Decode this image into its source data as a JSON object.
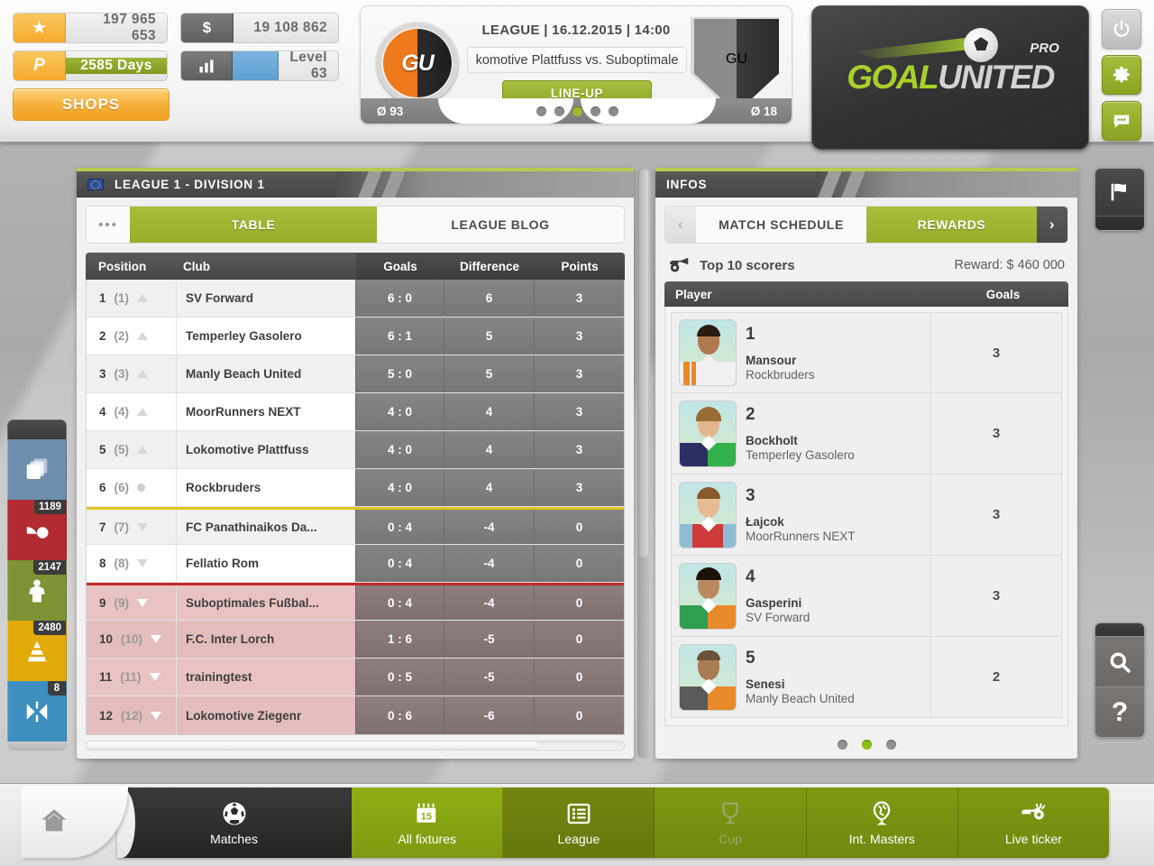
{
  "header": {
    "resources": [
      {
        "icon": "star-icon",
        "value": "197 965 653",
        "style": "gold"
      },
      {
        "icon": "dollar-icon",
        "value": "19 108 862",
        "style": "dark"
      },
      {
        "icon": "premium-p-icon",
        "value": "2585 Days",
        "style": "gold-green"
      },
      {
        "icon": "bar-chart-icon",
        "value": "Level 63",
        "style": "dark-blue"
      }
    ],
    "shops_label": "SHOPS",
    "match": {
      "meta": "LEAGUE | 16.12.2015 | 14:00",
      "fixture": "komotive Plattfuss vs. Suboptimale",
      "lineup_label": "LINE-UP",
      "home_avg": "Ø 93",
      "away_avg": "Ø 18",
      "home_crest_text": "GU",
      "away_crest_text": "GU",
      "dots": 5,
      "active_dot": 2
    },
    "logo": {
      "primary": "GOAL",
      "secondary": "UNITED",
      "suffix": "PRO"
    },
    "buttons": [
      {
        "name": "power-icon",
        "glyph": "⏻",
        "style": "gray"
      },
      {
        "name": "gear-icon",
        "glyph": "✲",
        "style": "green"
      },
      {
        "name": "chat-icon",
        "glyph": "●●●",
        "style": "green"
      }
    ]
  },
  "left_rail": [
    {
      "name": "sidebar-item-squad",
      "badge": "",
      "color": "#6e8fae"
    },
    {
      "name": "sidebar-item-injuries",
      "badge": "1189",
      "color": "#b22b30"
    },
    {
      "name": "sidebar-item-players",
      "badge": "2147",
      "color": "#7d9335"
    },
    {
      "name": "sidebar-item-training",
      "badge": "2480",
      "color": "#e2ab08"
    },
    {
      "name": "sidebar-item-tactics",
      "badge": "8",
      "color": "#3d8fbf"
    }
  ],
  "right_rail": [
    {
      "name": "flag-icon"
    },
    {
      "name": "search-icon"
    },
    {
      "name": "help-icon",
      "glyph": "?"
    }
  ],
  "league_panel": {
    "title": "LEAGUE 1 - DIVISION 1",
    "tabs": [
      {
        "label": "•••",
        "active": false,
        "name": "tab-more"
      },
      {
        "label": "TABLE",
        "active": true,
        "name": "tab-table"
      },
      {
        "label": "LEAGUE BLOG",
        "active": false,
        "name": "tab-league-blog"
      }
    ],
    "columns": [
      "Position",
      "Club",
      "Goals",
      "Difference",
      "Points"
    ],
    "rows": [
      {
        "pos": "1",
        "prev": "(1)",
        "trend": "up",
        "club": "SV Forward",
        "goals": "6 : 0",
        "diff": "6",
        "points": "3",
        "zone": "normal"
      },
      {
        "pos": "2",
        "prev": "(2)",
        "trend": "up",
        "club": "Temperley Gasolero",
        "goals": "6 : 1",
        "diff": "5",
        "points": "3",
        "zone": "normal"
      },
      {
        "pos": "3",
        "prev": "(3)",
        "trend": "up",
        "club": "Manly Beach United",
        "goals": "5 : 0",
        "diff": "5",
        "points": "3",
        "zone": "normal"
      },
      {
        "pos": "4",
        "prev": "(4)",
        "trend": "up",
        "club": "MoorRunners NEXT",
        "goals": "4 : 0",
        "diff": "4",
        "points": "3",
        "zone": "normal"
      },
      {
        "pos": "5",
        "prev": "(5)",
        "trend": "up",
        "club": "Lokomotive Plattfuss",
        "goals": "4 : 0",
        "diff": "4",
        "points": "3",
        "zone": "normal"
      },
      {
        "pos": "6",
        "prev": "(6)",
        "trend": "same",
        "club": "Rockbruders",
        "goals": "4 : 0",
        "diff": "4",
        "points": "3",
        "zone": "normal"
      },
      {
        "pos": "7",
        "prev": "(7)",
        "trend": "down",
        "club": "FC Panathinaikos Da...",
        "goals": "0 : 4",
        "diff": "-4",
        "points": "0",
        "zone": "yellow"
      },
      {
        "pos": "8",
        "prev": "(8)",
        "trend": "down",
        "club": "Fellatio Rom",
        "goals": "0 : 4",
        "diff": "-4",
        "points": "0",
        "zone": "normal"
      },
      {
        "pos": "9",
        "prev": "(9)",
        "trend": "down",
        "club": "Suboptimales Fußbal...",
        "goals": "0 : 4",
        "diff": "-4",
        "points": "0",
        "zone": "red"
      },
      {
        "pos": "10",
        "prev": "(10)",
        "trend": "down",
        "club": "F.C. Inter Lorch",
        "goals": "1 : 6",
        "diff": "-5",
        "points": "0",
        "zone": "reldown"
      },
      {
        "pos": "11",
        "prev": "(11)",
        "trend": "down",
        "club": "trainingtest",
        "goals": "0 : 5",
        "diff": "-5",
        "points": "0",
        "zone": "reldown"
      },
      {
        "pos": "12",
        "prev": "(12)",
        "trend": "down",
        "club": "Lokomotive Ziegenr",
        "goals": "0 : 6",
        "diff": "-6",
        "points": "0",
        "zone": "reldown"
      }
    ]
  },
  "infos_panel": {
    "title": "INFOS",
    "tabs": [
      {
        "label": "‹",
        "active": false,
        "name": "tab-prev-arrow"
      },
      {
        "label": "MATCH SCHEDULE",
        "active": false,
        "name": "tab-match-schedule"
      },
      {
        "label": "REWARDS",
        "active": true,
        "name": "tab-rewards"
      },
      {
        "label": "›",
        "active": false,
        "name": "tab-next-arrow"
      }
    ],
    "section_title": "Top 10 scorers",
    "reward": "Reward: $ 460 000",
    "columns": [
      "Player",
      "Goals"
    ],
    "scorers": [
      {
        "rank": "1",
        "name": "Mansour",
        "club": "Rockbruders",
        "goals": "3",
        "shirt_a": "#f0f0f0",
        "shirt_b": "#e8892a",
        "hair": "#2b1c12",
        "skin": "#b0784f"
      },
      {
        "rank": "2",
        "name": "Bockholt",
        "club": "Temperley Gasolero",
        "goals": "3",
        "shirt_a": "#2c2f63",
        "shirt_b": "#33b14a",
        "hair": "#9a6b37",
        "skin": "#e3b58c"
      },
      {
        "rank": "3",
        "name": "Łajcok",
        "club": "MoorRunners NEXT",
        "goals": "3",
        "shirt_a": "#8fbcd4",
        "shirt_b": "#cf3b3b",
        "hair": "#8a5a2c",
        "skin": "#e6bb95"
      },
      {
        "rank": "4",
        "name": "Gasperini",
        "club": "SV Forward",
        "goals": "3",
        "shirt_a": "#2f9e4f",
        "shirt_b": "#e8892a",
        "hair": "#1d1208",
        "skin": "#b98a62"
      },
      {
        "rank": "5",
        "name": "Senesi",
        "club": "Manly Beach United",
        "goals": "2",
        "shirt_a": "#5a5a5a",
        "shirt_b": "#e8892a",
        "hair": "#6b523a",
        "skin": "#a97c54"
      }
    ],
    "page_dots": 3,
    "active_page_dot": 1
  },
  "bottom_nav": {
    "home_label": "",
    "items": [
      {
        "label": "Matches",
        "icon": "soccer-ball-icon",
        "style": "dark",
        "name": "nav-matches"
      },
      {
        "label": "All fixtures",
        "icon": "calendar-15-icon",
        "style": "gbright",
        "name": "nav-all-fixtures",
        "badge": "15"
      },
      {
        "label": "League",
        "icon": "list-icon",
        "style": "gmid",
        "name": "nav-league"
      },
      {
        "label": "Cup",
        "icon": "trophy-icon",
        "style": "g dim",
        "name": "nav-cup"
      },
      {
        "label": "Int. Masters",
        "icon": "globe-trophy-icon",
        "style": "g",
        "name": "nav-int-masters"
      },
      {
        "label": "Live ticker",
        "icon": "whistle-icon",
        "style": "g",
        "name": "nav-live-ticker"
      }
    ]
  }
}
